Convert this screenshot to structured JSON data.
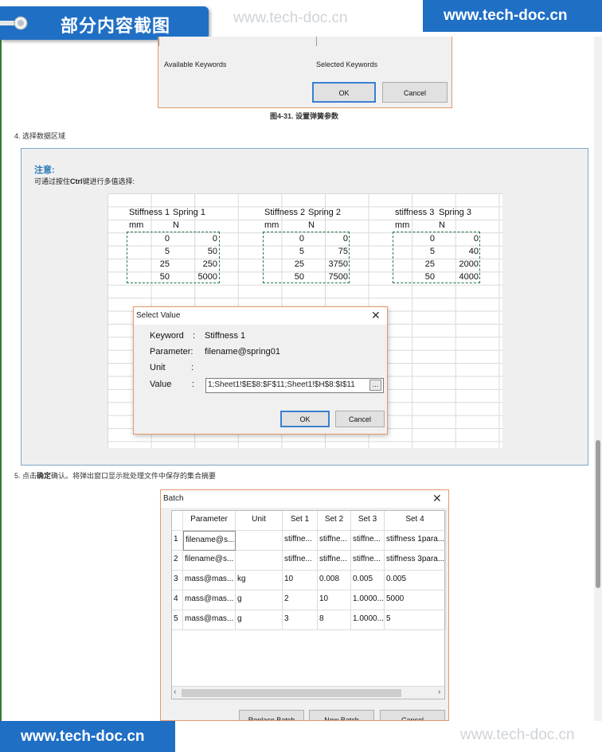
{
  "banner": {
    "tag": "部分内容截图",
    "brand_top": "www.tech-doc.cn",
    "brand_bottom": "www.tech-doc.cn",
    "watermark": "www.tech-doc.cn"
  },
  "top_dialog": {
    "available_label": "Available Keywords",
    "selected_label": "Selected Keywords",
    "ok": "OK",
    "cancel": "Cancel"
  },
  "figure_caption": "图4-31. 设置弹簧参数",
  "step4": "4. 选择数据区域",
  "note": {
    "title": "注意:",
    "text_pre": "可通过按住",
    "text_key": "Ctrl",
    "text_post": "键进行多值选择:"
  },
  "sheet": {
    "blocks": [
      {
        "h1": "Stiffness 1",
        "h2": "Spring 1",
        "u1": "mm",
        "u2": "N",
        "rows": [
          [
            "0",
            "0"
          ],
          [
            "5",
            "50"
          ],
          [
            "25",
            "250"
          ],
          [
            "50",
            "5000"
          ]
        ]
      },
      {
        "h1": "Stiffness 2",
        "h2": "Spring 2",
        "u1": "mm",
        "u2": "N",
        "rows": [
          [
            "0",
            "0"
          ],
          [
            "5",
            "75"
          ],
          [
            "25",
            "3750"
          ],
          [
            "50",
            "7500"
          ]
        ]
      },
      {
        "h1": "stiffness 3",
        "h2": "Spring 3",
        "u1": "mm",
        "u2": "N",
        "rows": [
          [
            "0",
            "0"
          ],
          [
            "5",
            "40"
          ],
          [
            "25",
            "2000"
          ],
          [
            "50",
            "4000"
          ]
        ]
      }
    ]
  },
  "select_value": {
    "title": "Select Value",
    "keyword_label": "Keyword",
    "keyword": "Stiffness 1",
    "parameter_label": "Parameter:",
    "parameter": "filename@spring01",
    "unit_label": "Unit",
    "value_label": "Value",
    "value": "1;Sheet1!$E$8:$F$11;Sheet1!$H$8:$I$11",
    "browse": "...",
    "ok": "OK",
    "cancel": "Cancel"
  },
  "step5": {
    "pre": "5. 点击",
    "bold": "确定",
    "post": "确认。将弹出窗口显示批处理文件中保存的集合摘要"
  },
  "batch": {
    "title": "Batch",
    "headers": [
      "",
      "Parameter",
      "Unit",
      "Set 1",
      "Set 2",
      "Set 3",
      "Set 4"
    ],
    "rows": [
      [
        "1",
        "filename@s...",
        "",
        "stiffne...",
        "stiffne...",
        "stiffne...",
        "stiffness 1para..."
      ],
      [
        "2",
        "filename@s...",
        "",
        "stiffne...",
        "stiffne...",
        "stiffne...",
        "stiffness 3para..."
      ],
      [
        "3",
        "mass@mas...",
        "kg",
        "10",
        "0.008",
        "0.005",
        "0.005"
      ],
      [
        "4",
        "mass@mas...",
        "g",
        "2",
        "10",
        "1.0000...",
        "5000"
      ],
      [
        "5",
        "mass@mas...",
        "g",
        "3",
        "8",
        "1.0000...",
        "5"
      ]
    ],
    "buttons": [
      "Replace Batch",
      "New Batch",
      "Cancel"
    ]
  }
}
